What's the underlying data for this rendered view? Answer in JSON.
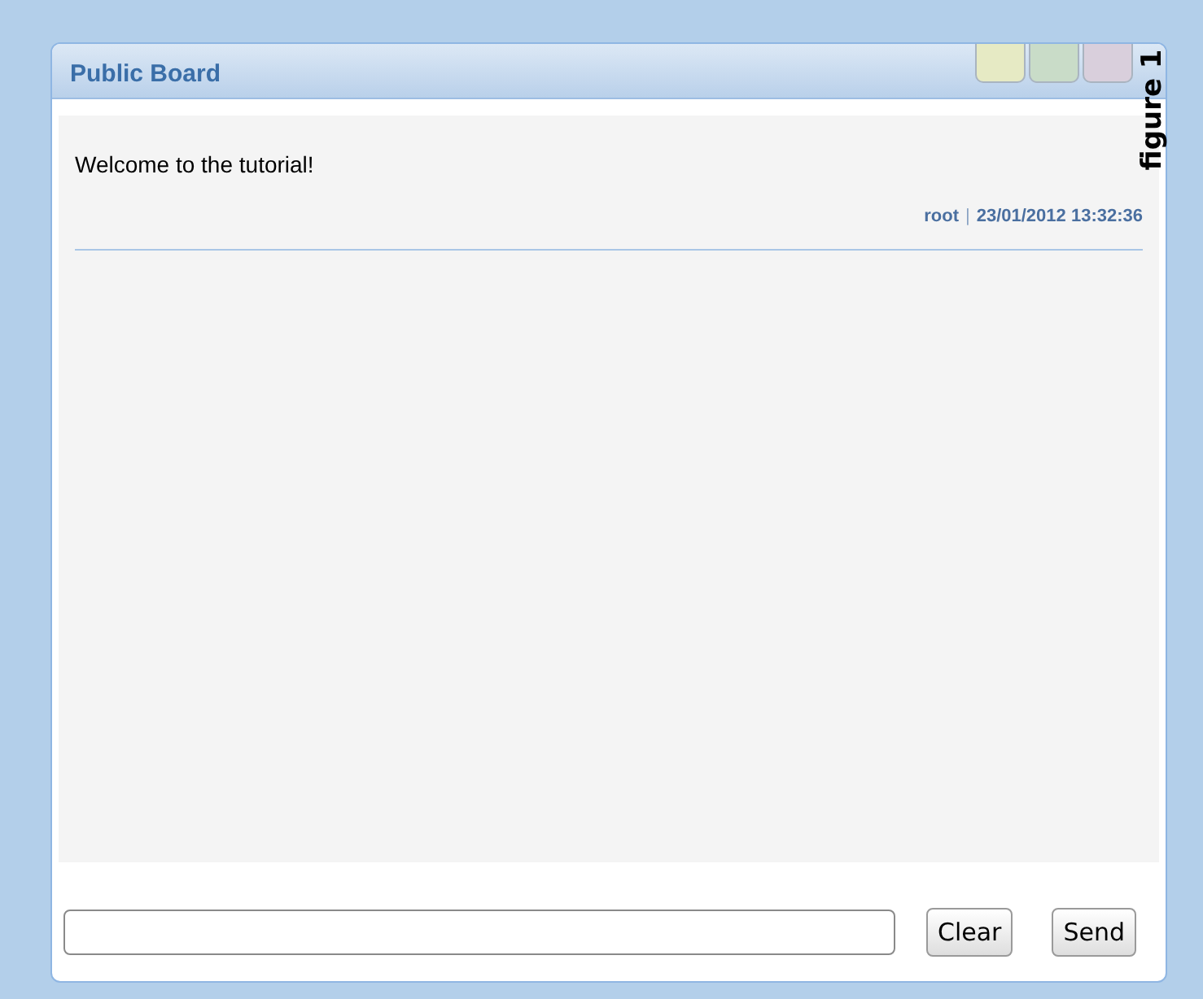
{
  "window": {
    "title": "Public Board"
  },
  "window_buttons": [
    {
      "color": "#e6eac4"
    },
    {
      "color": "#c9dcc8"
    },
    {
      "color": "#d9cfdc"
    }
  ],
  "messages": [
    {
      "text": "Welcome to the tutorial!",
      "author": "root",
      "separator": "|",
      "time": "23/01/2012 13:32:36"
    }
  ],
  "composer": {
    "buttons": [
      "Clear",
      "Send"
    ]
  },
  "figure_label": "figure 1"
}
